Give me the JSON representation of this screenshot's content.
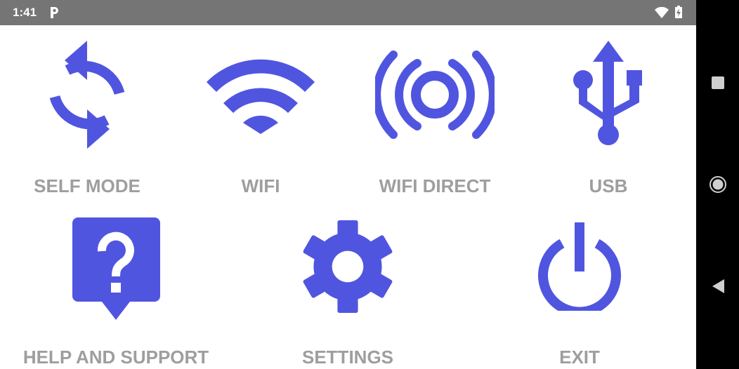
{
  "status_bar": {
    "time": "1:41",
    "notification_icon": "p-icon",
    "wifi_icon": "wifi-signal-icon",
    "battery_icon": "battery-charging-icon",
    "background_color": "#757575"
  },
  "nav_bar": {
    "recents_icon": "square-icon",
    "home_icon": "circle-icon",
    "back_icon": "triangle-back-icon",
    "background_color": "#000000"
  },
  "theme": {
    "accent_color": "#5055e0",
    "label_color": "#9e9e9e"
  },
  "menu": {
    "self_mode": {
      "label": "SELF MODE",
      "icon": "sync-icon"
    },
    "wifi": {
      "label": "WIFI",
      "icon": "wifi-icon"
    },
    "wifi_direct": {
      "label": "WIFI DIRECT",
      "icon": "broadcast-icon"
    },
    "usb": {
      "label": "USB",
      "icon": "usb-icon"
    },
    "help": {
      "label": "HELP AND SUPPORT",
      "icon": "help-icon"
    },
    "settings": {
      "label": "SETTINGS",
      "icon": "gear-icon"
    },
    "exit": {
      "label": "EXIT",
      "icon": "power-icon"
    }
  }
}
